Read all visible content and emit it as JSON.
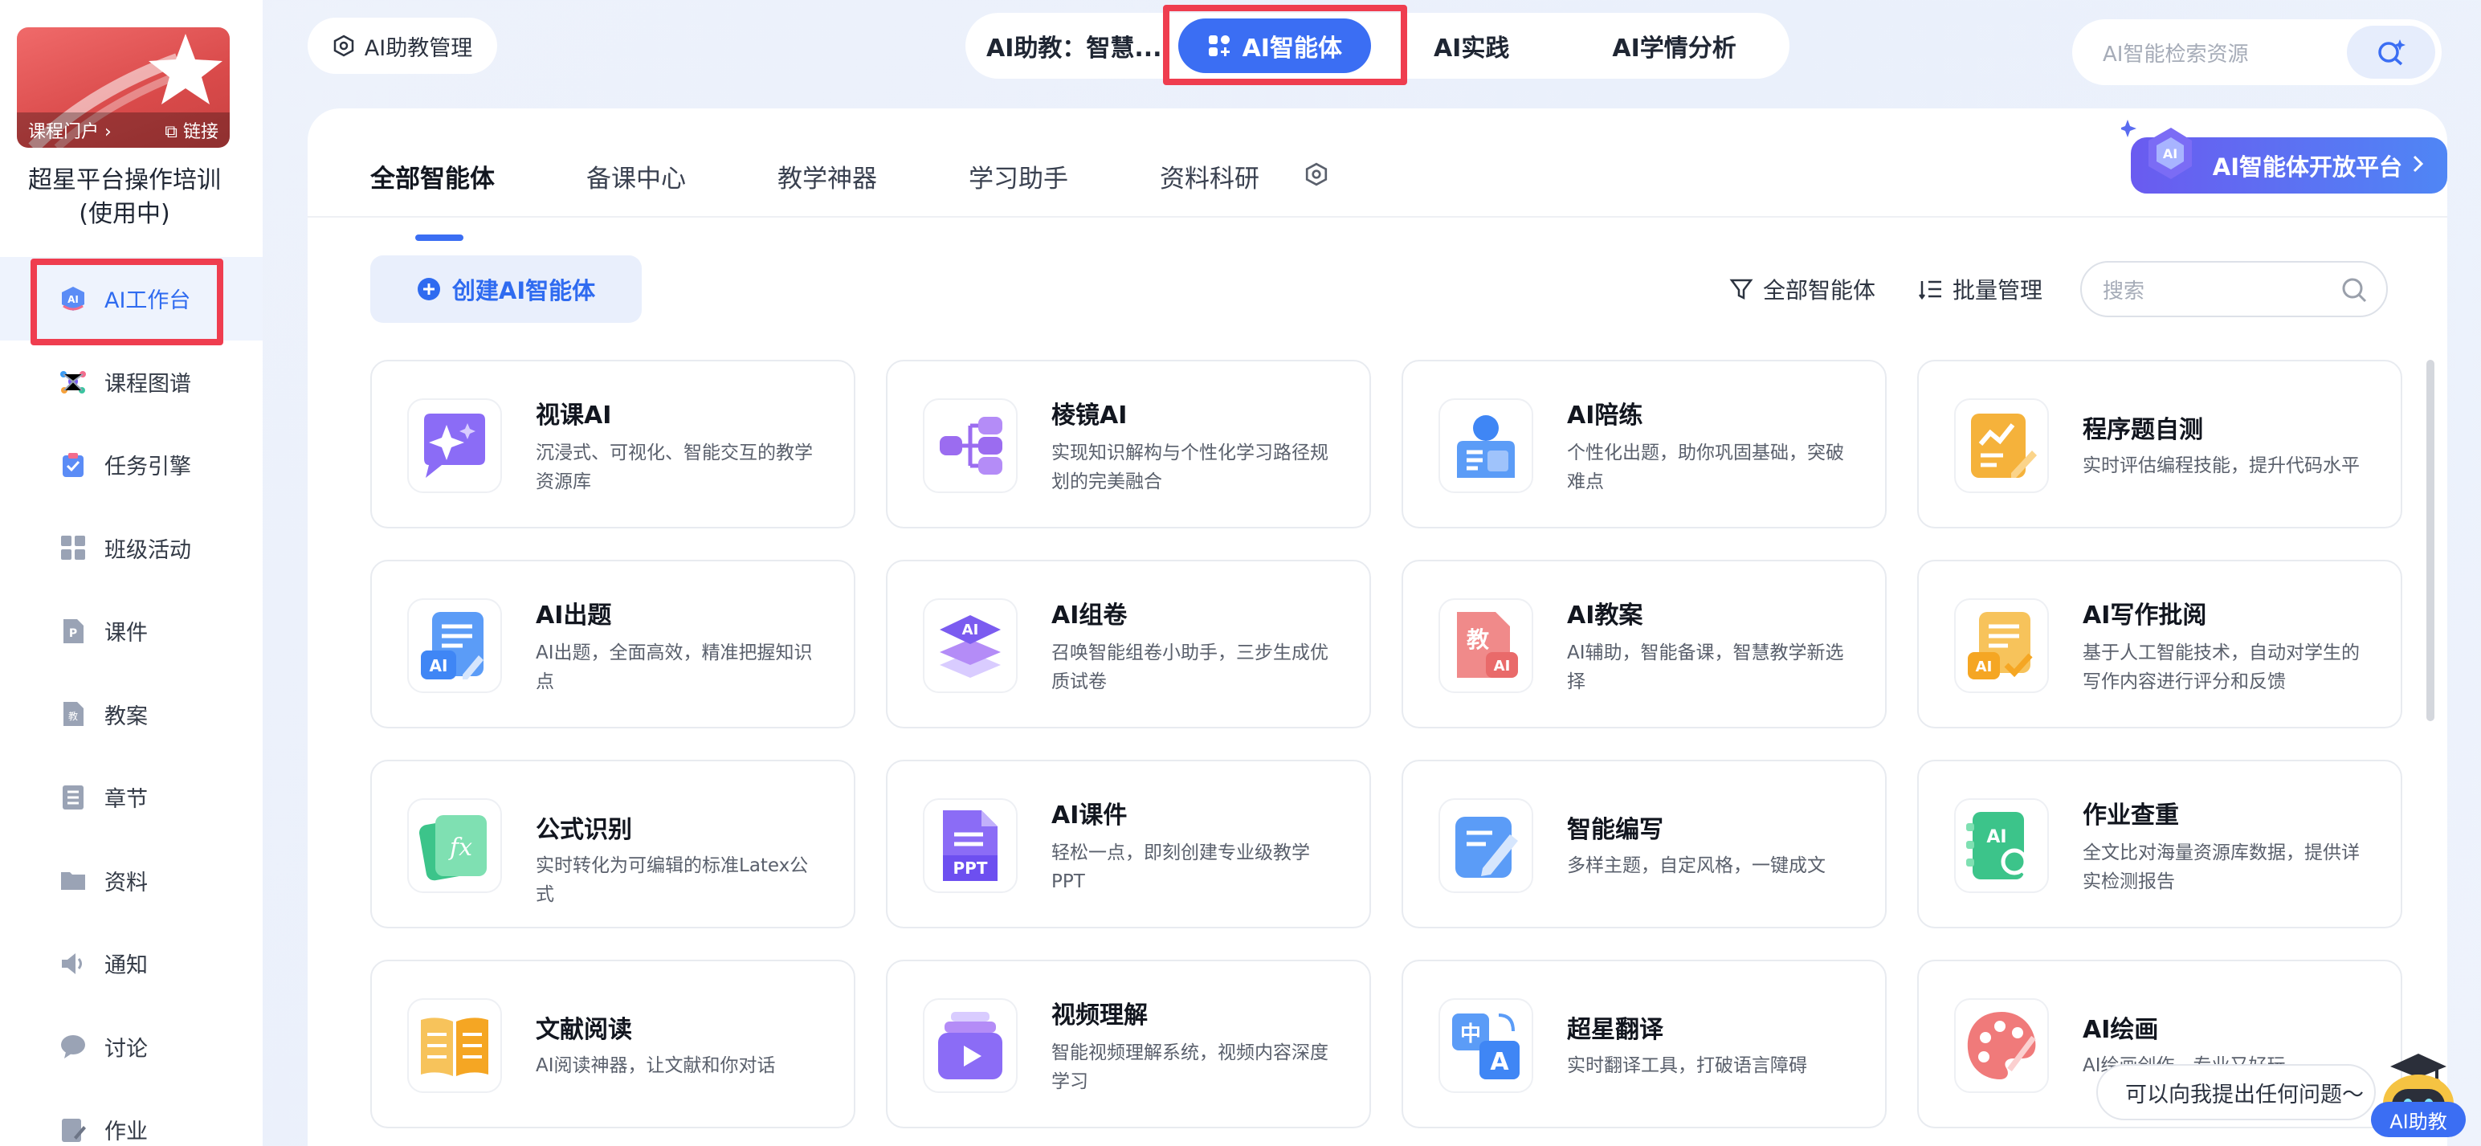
{
  "sidebar": {
    "cover": {
      "portal_label": "课程门户 ›",
      "link_label": "⧉ 链接"
    },
    "course_name_line1": "超星平台操作培训",
    "course_name_line2": "(使用中)",
    "items": [
      {
        "label": "AI工作台",
        "icon": "ai-workbench-icon",
        "active": true
      },
      {
        "label": "课程图谱",
        "icon": "knowledge-graph-icon"
      },
      {
        "label": "任务引擎",
        "icon": "task-clipboard-icon"
      },
      {
        "label": "班级活动",
        "icon": "grid-squares-icon"
      },
      {
        "label": "课件",
        "icon": "courseware-p-icon"
      },
      {
        "label": "教案",
        "icon": "lesson-plan-icon"
      },
      {
        "label": "章节",
        "icon": "chapter-list-icon"
      },
      {
        "label": "资料",
        "icon": "folder-icon"
      },
      {
        "label": "通知",
        "icon": "speaker-icon"
      },
      {
        "label": "讨论",
        "icon": "chat-bubble-icon"
      },
      {
        "label": "作业",
        "icon": "homework-pen-icon"
      }
    ]
  },
  "topbar": {
    "manage_label": "AI助教管理",
    "tabs": [
      {
        "label": "AI助教：智慧..."
      },
      {
        "label": "AI智能体",
        "current": true
      },
      {
        "label": "AI实践"
      },
      {
        "label": "AI学情分析"
      }
    ],
    "search_placeholder": "AI智能检索资源"
  },
  "panel": {
    "sub_tabs": [
      "全部智能体",
      "备课中心",
      "教学神器",
      "学习助手",
      "资料科研"
    ],
    "open_platform_label": "AI智能体开放平台",
    "create_label": "创建AI智能体",
    "filter_label": "全部智能体",
    "batch_label": "批量管理",
    "search_placeholder": "搜索",
    "cards": [
      {
        "title": "视课AI",
        "desc": "沉浸式、可视化、智能交互的教学资源库",
        "icon": "sparkle-chat-icon"
      },
      {
        "title": "棱镜AI",
        "desc": "实现知识解构与个性化学习路径规划的完美融合",
        "icon": "mind-map-icon"
      },
      {
        "title": "AI陪练",
        "desc": "个性化出题，助你巩固基础，突破难点",
        "icon": "student-book-icon"
      },
      {
        "title": "程序题自测",
        "desc": "实时评估编程技能，提升代码水平",
        "icon": "code-chart-icon"
      },
      {
        "title": "AI出题",
        "desc": "AI出题，全面高效，精准把握知识点",
        "icon": "ai-question-icon"
      },
      {
        "title": "AI组卷",
        "desc": "召唤智能组卷小助手，三步生成优质试卷",
        "icon": "layers-ai-icon"
      },
      {
        "title": "AI教案",
        "desc": "AI辅助，智能备课，智慧教学新选择",
        "icon": "lesson-ai-icon"
      },
      {
        "title": "AI写作批阅",
        "desc": "基于人工智能技术，自动对学生的写作内容进行评分和反馈",
        "icon": "ai-check-icon"
      },
      {
        "title": "公式识别",
        "desc": "实时转化为可编辑的标准Latex公式",
        "icon": "formula-fx-icon"
      },
      {
        "title": "AI课件",
        "desc": "轻松一点，即刻创建专业级教学PPT",
        "icon": "ppt-file-icon"
      },
      {
        "title": "智能编写",
        "desc": "多样主题，自定风格，一键成文",
        "icon": "edit-doc-icon"
      },
      {
        "title": "作业查重",
        "desc": "全文比对海量资源库数据，提供详实检测报告",
        "icon": "ai-search-icon"
      },
      {
        "title": "文献阅读",
        "desc": "AI阅读神器，让文献和你对话",
        "icon": "open-book-icon"
      },
      {
        "title": "视频理解",
        "desc": "智能视频理解系统，视频内容深度学习",
        "icon": "video-stack-icon"
      },
      {
        "title": "超星翻译",
        "desc": "实时翻译工具，打破语言障碍",
        "icon": "translate-icon"
      },
      {
        "title": "AI绘画",
        "desc": "AI绘画创作，专业又好玩",
        "icon": "palette-icon"
      }
    ]
  },
  "assistant": {
    "bubble_text": "可以向我提出任何问题～",
    "label": "AI助教"
  },
  "colors": {
    "accent": "#3b6ef3",
    "highlight": "#ef3d4f"
  }
}
